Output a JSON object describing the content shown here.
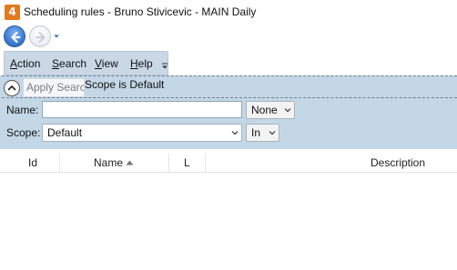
{
  "window": {
    "title": "Scheduling rules - Bruno Stivicevic - MAIN Daily",
    "app_icon_glyph": "4",
    "app_icon_color": "#e07a1f"
  },
  "nav": {
    "back_icon": "arrow-left-icon",
    "forward_icon": "arrow-right-icon",
    "history_icon": "chevron-down-icon"
  },
  "menu": {
    "items": [
      {
        "label": "Action",
        "mnemonic": "A"
      },
      {
        "label": "Search",
        "mnemonic": "S"
      },
      {
        "label": "View",
        "mnemonic": "V"
      },
      {
        "label": "Help",
        "mnemonic": "H"
      }
    ],
    "overflow_icon": "toolbar-overflow-icon"
  },
  "search": {
    "collapse_icon": "chevron-up-icon",
    "apply_placeholder": "Apply Search",
    "summary": "Scope is Default",
    "name_label": "Name:",
    "name_value": "",
    "name_operator": "None",
    "scope_label": "Scope:",
    "scope_value": "Default",
    "scope_operator": "In"
  },
  "grid": {
    "columns": [
      "Id",
      "Name",
      "L",
      "Description"
    ],
    "sorted_column": "Name",
    "sort_direction": "ascending",
    "rows": []
  },
  "colors": {
    "panel_bg": "#c3d7e6",
    "menubar_bg": "#cad8e6",
    "accent_blue": "#3f7fd6"
  }
}
